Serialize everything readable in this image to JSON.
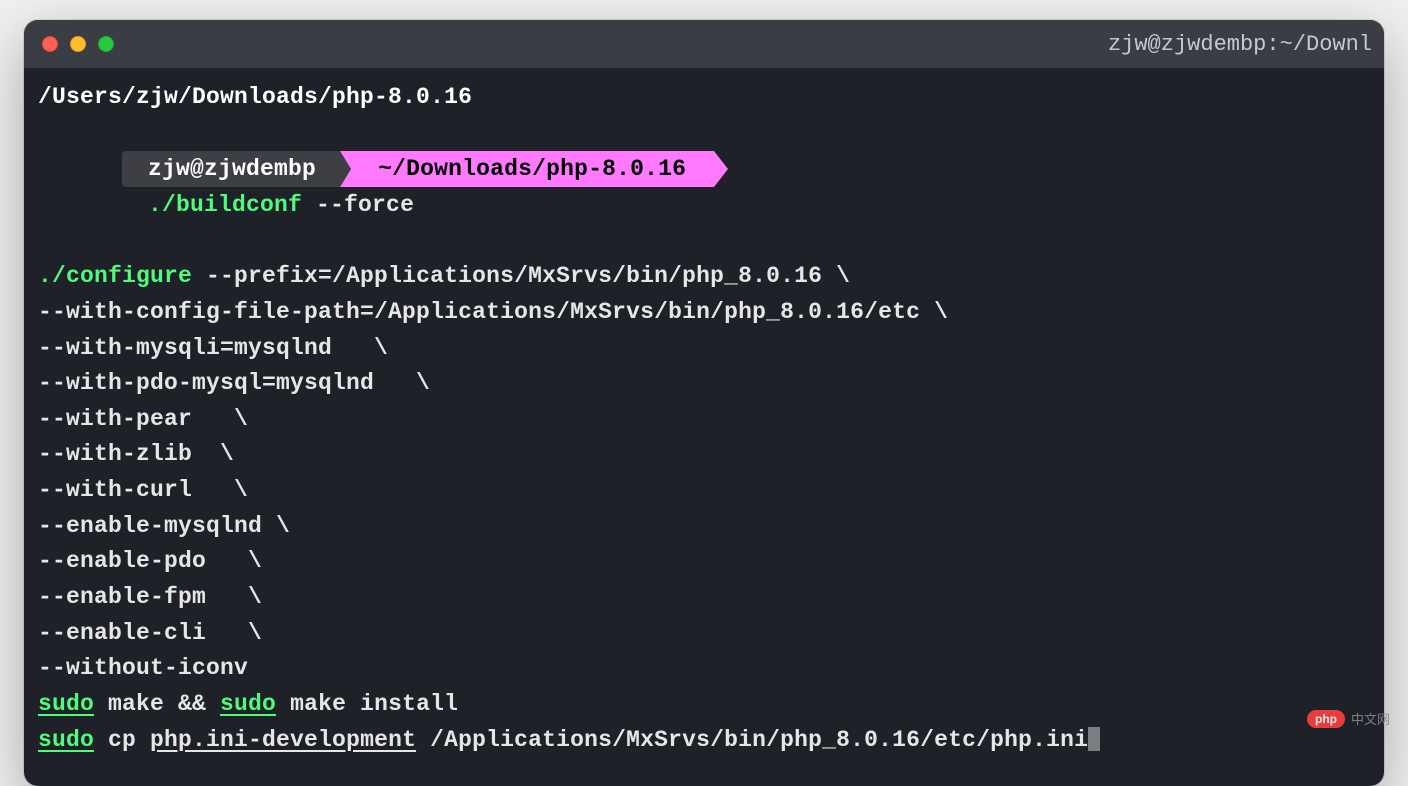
{
  "window": {
    "title": "zjw@zjwdembp:~/Downl"
  },
  "terminal": {
    "pwd": "/Users/zjw/Downloads/php-8.0.16",
    "prompt": {
      "user": "zjw@zjwdembp",
      "path": "~/Downloads/php-8.0.16"
    },
    "prompt_cmd": {
      "cmd": "./buildconf",
      "args": " --force"
    },
    "lines": [
      {
        "cmd": "./configure",
        "rest": " --prefix=/Applications/MxSrvs/bin/php_8.0.16 \\"
      },
      {
        "rest": "--with-config-file-path=/Applications/MxSrvs/bin/php_8.0.16/etc \\"
      },
      {
        "rest": "--with-mysqli=mysqlnd   \\"
      },
      {
        "rest": "--with-pdo-mysql=mysqlnd   \\"
      },
      {
        "rest": "--with-pear   \\"
      },
      {
        "rest": "--with-zlib  \\"
      },
      {
        "rest": "--with-curl   \\"
      },
      {
        "rest": "--enable-mysqlnd \\"
      },
      {
        "rest": "--enable-pdo   \\"
      },
      {
        "rest": "--enable-fpm   \\"
      },
      {
        "rest": "--enable-cli   \\"
      },
      {
        "rest": "--without-iconv"
      }
    ],
    "make_line": {
      "sudo1": "sudo",
      "make1": " make ",
      "amp": "&& ",
      "sudo2": "sudo",
      "make2": " make ",
      "install": "install"
    },
    "cp_line": {
      "sudo": "sudo",
      "cp": " cp ",
      "file": "php.ini-development",
      "dest": " /Applications/MxSrvs/bin/php_8.0.16/etc/php.ini"
    }
  },
  "watermark": {
    "badge": "php",
    "text": "中文网"
  }
}
